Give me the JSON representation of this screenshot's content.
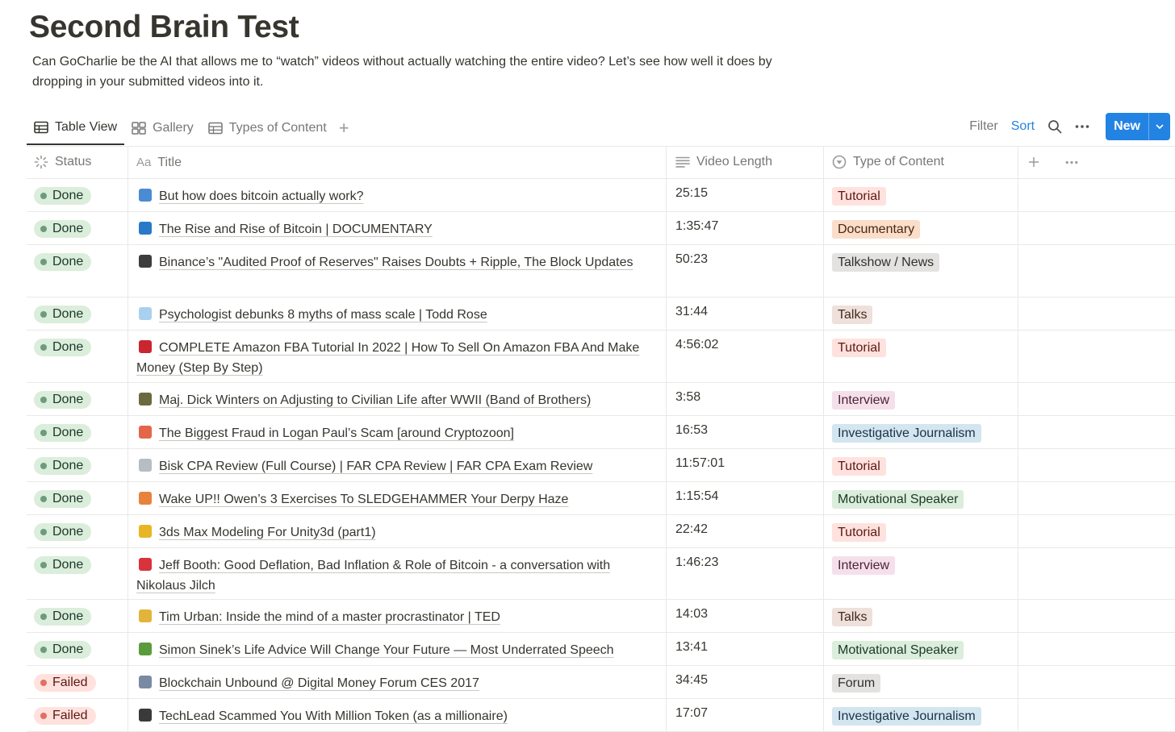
{
  "page": {
    "title": "Second Brain Test",
    "description": "Can GoCharlie be the AI that allows me to “watch” videos without actually watching the entire video? Let’s see how well it does by dropping in your submitted videos into it."
  },
  "views": {
    "tabs": [
      {
        "label": "Table View",
        "icon": "table-icon"
      },
      {
        "label": "Gallery",
        "icon": "gallery-icon"
      },
      {
        "label": "Types of Content",
        "icon": "table-icon"
      }
    ],
    "add_label": "+"
  },
  "toolbar": {
    "filter_label": "Filter",
    "sort_label": "Sort",
    "new_label": "New",
    "accent": "#2383e2"
  },
  "table": {
    "columns": [
      {
        "label": "Status",
        "icon": "status-icon"
      },
      {
        "label": "Title",
        "icon": "text-icon",
        "prefix": "Aa"
      },
      {
        "label": "Video Length",
        "icon": "lines-icon"
      },
      {
        "label": "Type of Content",
        "icon": "select-icon"
      }
    ],
    "rows": [
      {
        "status": "Done",
        "emoji_color": "#4a8bd4",
        "title": "But how does bitcoin actually work?",
        "length": "25:15",
        "type": "Tutorial",
        "tag": "red",
        "height": 41
      },
      {
        "status": "Done",
        "emoji_color": "#2a79c9",
        "title": "The Rise and Rise of Bitcoin | DOCUMENTARY",
        "length": "1:35:47",
        "type": "Documentary",
        "tag": "orange",
        "height": 41
      },
      {
        "status": "Done",
        "emoji_color": "#3d3d3d",
        "title": "Binance’s \"Audited Proof of Reserves\" Raises Doubts + Ripple, The Block Updates",
        "length": "50:23",
        "type": "Talkshow / News",
        "tag": "gray",
        "height": 65
      },
      {
        "status": "Done",
        "emoji_color": "#a9d1ef",
        "title": "Psychologist debunks 8 myths of mass scale | Todd Rose",
        "length": "31:44",
        "type": "Talks",
        "tag": "brown",
        "height": 41
      },
      {
        "status": "Done",
        "emoji_color": "#c9262f",
        "title": "COMPLETE Amazon FBA Tutorial In 2022 | How To Sell On Amazon FBA And Make Money (Step By Step)",
        "length": "4:56:02",
        "type": "Tutorial",
        "tag": "red",
        "height": 65
      },
      {
        "status": "Done",
        "emoji_color": "#6b6a3e",
        "title": "Maj. Dick Winters on Adjusting to Civilian Life after WWII (Band of Brothers)",
        "length": "3:58",
        "type": "Interview",
        "tag": "pink",
        "height": 41
      },
      {
        "status": "Done",
        "emoji_color": "#e3664a",
        "title": "The Biggest Fraud in Logan Paul’s Scam [around Cryptozoon]",
        "length": "16:53",
        "type": "Investigative Journalism",
        "tag": "blue",
        "height": 41
      },
      {
        "status": "Done",
        "emoji_color": "#b8bcc4",
        "title": "Bisk CPA Review (Full Course) | FAR CPA Review | FAR CPA Exam Review",
        "length": "11:57:01",
        "type": "Tutorial",
        "tag": "red",
        "height": 41
      },
      {
        "status": "Done",
        "emoji_color": "#e8823d",
        "title": "Wake UP!! Owen’s 3 Exercises To SLEDGEHAMMER Your Derpy Haze",
        "length": "1:15:54",
        "type": "Motivational Speaker",
        "tag": "green",
        "height": 41
      },
      {
        "status": "Done",
        "emoji_color": "#e8b624",
        "title": "3ds Max Modeling For Unity3d (part1)",
        "length": "22:42",
        "type": "Tutorial",
        "tag": "red",
        "height": 41
      },
      {
        "status": "Done",
        "emoji_color": "#d8323d",
        "title": "Jeff Booth: Good Deflation, Bad Inflation & Role of Bitcoin - a conversation with Nikolaus Jilch",
        "length": "1:46:23",
        "type": "Interview",
        "tag": "pink",
        "height": 64
      },
      {
        "status": "Done",
        "emoji_color": "#e2b43a",
        "title": "Tim Urban: Inside the mind of a master procrastinator | TED",
        "length": "14:03",
        "type": "Talks",
        "tag": "brown",
        "height": 41
      },
      {
        "status": "Done",
        "emoji_color": "#5a9b3c",
        "title": "Simon Sinek’s Life Advice Will Change Your Future — Most Underrated Speech",
        "length": "13:41",
        "type": "Motivational Speaker",
        "tag": "green",
        "height": 41
      },
      {
        "status": "Failed",
        "emoji_color": "#7a8aa3",
        "title": "Blockchain Unbound @ Digital Money Forum CES 2017",
        "length": "34:45",
        "type": "Forum",
        "tag": "gray",
        "height": 41
      },
      {
        "status": "Failed",
        "emoji_color": "#3a3a3a",
        "title": "TechLead Scammed You With Million Token (as a millionaire)",
        "length": "17:07",
        "type": "Investigative Journalism",
        "tag": "blue",
        "height": 41
      }
    ]
  }
}
